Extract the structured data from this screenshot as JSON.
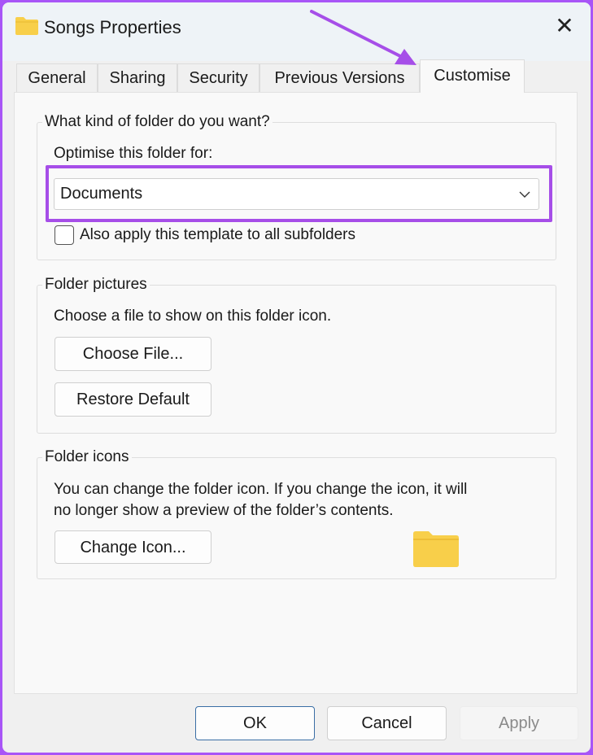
{
  "window": {
    "title": "Songs Properties",
    "close_icon": "close-icon"
  },
  "tabs": [
    {
      "label": "General"
    },
    {
      "label": "Sharing"
    },
    {
      "label": "Security"
    },
    {
      "label": "Previous Versions"
    },
    {
      "label": "Customise",
      "selected": true
    }
  ],
  "kind": {
    "legend": "What kind of folder do you want?",
    "optimise_label": "Optimise this folder for:",
    "optimise_value": "Documents",
    "subfolders_label": "Also apply this template to all subfolders",
    "subfolders_checked": false
  },
  "pictures": {
    "legend": "Folder pictures",
    "text": "Choose a file to show on this folder icon.",
    "choose_button": "Choose File...",
    "restore_button": "Restore Default"
  },
  "icons": {
    "legend": "Folder icons",
    "text_line1": "You can change the folder icon. If you change the icon, it will",
    "text_line2": "no longer show a preview of the folder’s contents.",
    "change_button": "Change Icon..."
  },
  "footer": {
    "ok": "OK",
    "cancel": "Cancel",
    "apply": "Apply"
  },
  "colors": {
    "highlight": "#a64ee8",
    "folder": "#f8cf4a"
  }
}
